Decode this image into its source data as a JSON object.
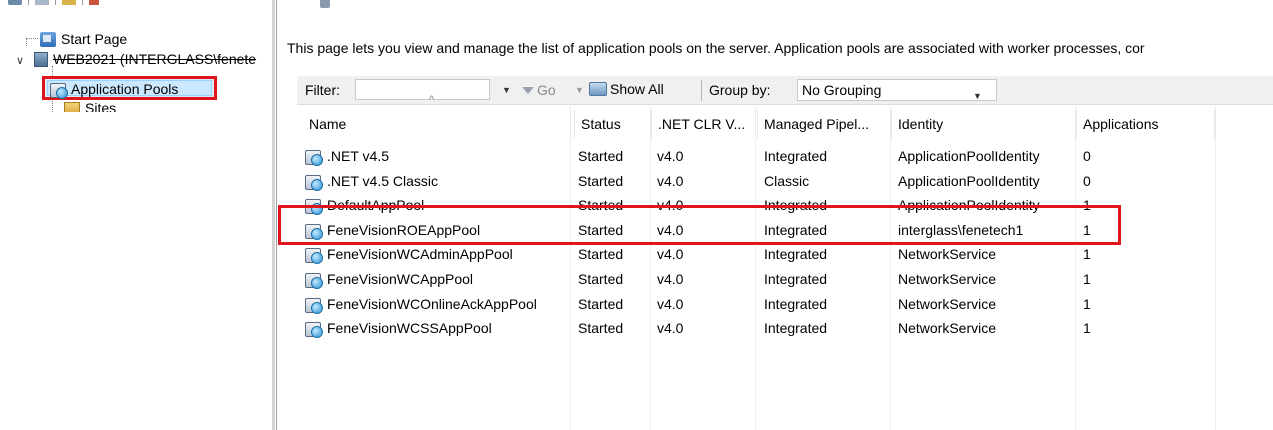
{
  "tree": {
    "items": [
      {
        "label": "Start Page",
        "icon": "start-page-icon"
      },
      {
        "label": "WEB2021 (INTERGLASS\\fenete",
        "icon": "server-icon"
      },
      {
        "label": "Application Pools",
        "icon": "app-pool-icon",
        "selected": true
      },
      {
        "label": "Sites",
        "icon": "sites-icon"
      }
    ]
  },
  "main": {
    "description": "This page lets you view and manage the list of application pools on the server. Application pools are associated with worker processes, cor"
  },
  "toolbar": {
    "filter_label": "Filter:",
    "filter_value": "",
    "go_label": "Go",
    "show_all_label": "Show All",
    "group_by_label": "Group by:",
    "group_by_value": "No Grouping"
  },
  "table": {
    "columns": [
      "Name",
      "Status",
      ".NET CLR V...",
      "Managed Pipel...",
      "Identity",
      "Applications"
    ],
    "rows": [
      {
        "name": ".NET v4.5",
        "status": "Started",
        "clr": "v4.0",
        "pipeline": "Integrated",
        "identity": "ApplicationPoolIdentity",
        "apps": "0"
      },
      {
        "name": ".NET v4.5 Classic",
        "status": "Started",
        "clr": "v4.0",
        "pipeline": "Classic",
        "identity": "ApplicationPoolIdentity",
        "apps": "0"
      },
      {
        "name": "DefaultAppPool",
        "status": "Started",
        "clr": "v4.0",
        "pipeline": "Integrated",
        "identity": "ApplicationPoolIdentity",
        "apps": "1"
      },
      {
        "name": "FeneVisionROEAppPool",
        "status": "Started",
        "clr": "v4.0",
        "pipeline": "Integrated",
        "identity": "interglass\\fenetech1",
        "apps": "1"
      },
      {
        "name": "FeneVisionWCAdminAppPool",
        "status": "Started",
        "clr": "v4.0",
        "pipeline": "Integrated",
        "identity": "NetworkService",
        "apps": "1"
      },
      {
        "name": "FeneVisionWCAppPool",
        "status": "Started",
        "clr": "v4.0",
        "pipeline": "Integrated",
        "identity": "NetworkService",
        "apps": "1"
      },
      {
        "name": "FeneVisionWCOnlineAckAppPool",
        "status": "Started",
        "clr": "v4.0",
        "pipeline": "Integrated",
        "identity": "NetworkService",
        "apps": "1"
      },
      {
        "name": "FeneVisionWCSSAppPool",
        "status": "Started",
        "clr": "v4.0",
        "pipeline": "Integrated",
        "identity": "NetworkService",
        "apps": "1"
      }
    ]
  },
  "colors": {
    "annotation_red": "#e0161c",
    "selection_blue": "#cce8ff"
  }
}
